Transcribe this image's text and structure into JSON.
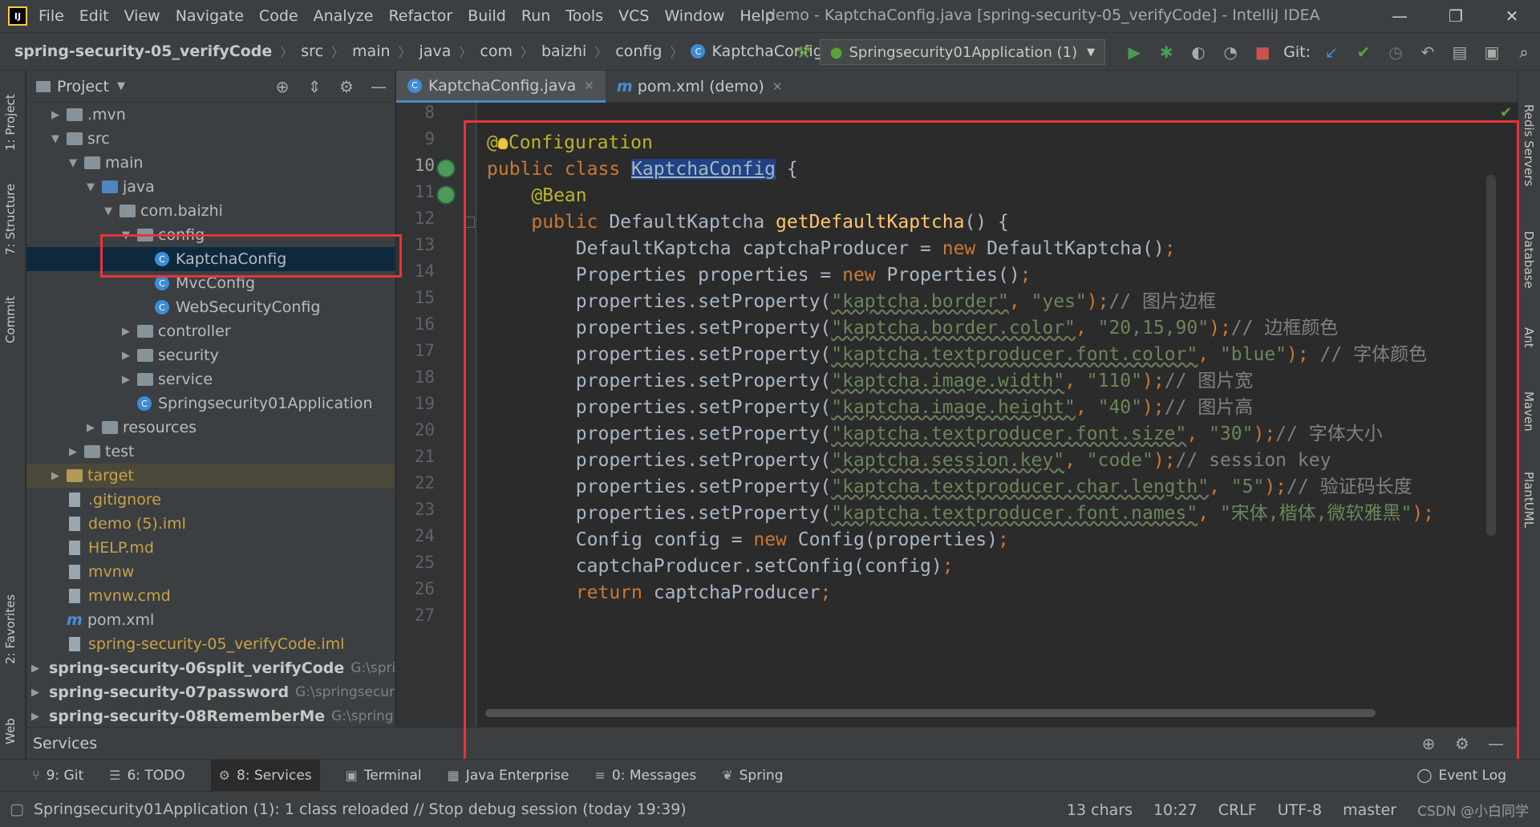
{
  "app": {
    "logo": "IJ",
    "window_title": "demo - KaptchaConfig.java [spring-security-05_verifyCode] - IntelliJ IDEA",
    "menu": [
      "File",
      "Edit",
      "View",
      "Navigate",
      "Code",
      "Analyze",
      "Refactor",
      "Build",
      "Run",
      "Tools",
      "VCS",
      "Window",
      "Help"
    ]
  },
  "breadcrumb": [
    "spring-security-05_verifyCode",
    "src",
    "main",
    "java",
    "com",
    "baizhi",
    "config",
    "KaptchaConfig"
  ],
  "toolbar": {
    "run_config": "Springsecurity01Application (1)",
    "git_label": "Git:"
  },
  "left_tool_tabs": [
    "1: Project",
    "7: Structure",
    "Commit",
    "2: Favorites",
    "Web"
  ],
  "right_tool_tabs": [
    "Redis Servers",
    "Database",
    "Ant",
    "Maven",
    "PlantUML"
  ],
  "project_panel": {
    "title": "Project",
    "tree": [
      {
        "label": ".mvn",
        "kind": "folder",
        "indent": 1,
        "expand": "closed"
      },
      {
        "label": "src",
        "kind": "folder",
        "indent": 1,
        "expand": "open"
      },
      {
        "label": "main",
        "kind": "folder",
        "indent": 2,
        "expand": "open"
      },
      {
        "label": "java",
        "kind": "src-folder",
        "indent": 3,
        "expand": "open"
      },
      {
        "label": "com.baizhi",
        "kind": "package",
        "indent": 4,
        "expand": "open"
      },
      {
        "label": "config",
        "kind": "package",
        "indent": 5,
        "expand": "open"
      },
      {
        "label": "KaptchaConfig",
        "kind": "class",
        "indent": 6,
        "expand": "none",
        "selected": true
      },
      {
        "label": "MvcConfig",
        "kind": "class",
        "indent": 6,
        "expand": "none"
      },
      {
        "label": "WebSecurityConfig",
        "kind": "class",
        "indent": 6,
        "expand": "none"
      },
      {
        "label": "controller",
        "kind": "package",
        "indent": 5,
        "expand": "closed"
      },
      {
        "label": "security",
        "kind": "package",
        "indent": 5,
        "expand": "closed"
      },
      {
        "label": "service",
        "kind": "package",
        "indent": 5,
        "expand": "closed"
      },
      {
        "label": "Springsecurity01Application",
        "kind": "class",
        "indent": 5,
        "expand": "none"
      },
      {
        "label": "resources",
        "kind": "folder",
        "indent": 3,
        "expand": "closed"
      },
      {
        "label": "test",
        "kind": "folder",
        "indent": 2,
        "expand": "closed"
      },
      {
        "label": "target",
        "kind": "target",
        "indent": 1,
        "expand": "closed",
        "excluded": true
      },
      {
        "label": ".gitignore",
        "kind": "file",
        "indent": 1,
        "expand": "none",
        "orange": true
      },
      {
        "label": "demo (5).iml",
        "kind": "file",
        "indent": 1,
        "expand": "none",
        "orange": true
      },
      {
        "label": "HELP.md",
        "kind": "file",
        "indent": 1,
        "expand": "none",
        "orange": true
      },
      {
        "label": "mvnw",
        "kind": "file",
        "indent": 1,
        "expand": "none",
        "orange": true
      },
      {
        "label": "mvnw.cmd",
        "kind": "file",
        "indent": 1,
        "expand": "none",
        "orange": true
      },
      {
        "label": "pom.xml",
        "kind": "maven",
        "indent": 1,
        "expand": "none"
      },
      {
        "label": "spring-security-05_verifyCode.iml",
        "kind": "file",
        "indent": 1,
        "expand": "none",
        "orange": true
      },
      {
        "label": "spring-security-06split_verifyCode",
        "kind": "module",
        "indent": 0,
        "expand": "closed",
        "path": "G:\\springs"
      },
      {
        "label": "spring-security-07password",
        "kind": "module",
        "indent": 0,
        "expand": "closed",
        "path": "G:\\springsecurit"
      },
      {
        "label": "spring-security-08RememberMe",
        "kind": "module",
        "indent": 0,
        "expand": "closed",
        "path": "G:\\springse"
      }
    ]
  },
  "editor_tabs": [
    {
      "label": "KaptchaConfig.java",
      "icon": "C",
      "active": true
    },
    {
      "label": "pom.xml (demo)",
      "icon": "m",
      "active": false
    }
  ],
  "code": {
    "line_numbers": [
      "8",
      "9",
      "10",
      "11",
      "12",
      "13",
      "14",
      "15",
      "16",
      "17",
      "18",
      "19",
      "20",
      "21",
      "22",
      "23",
      "24",
      "25",
      "26",
      "27"
    ],
    "current_line": "10",
    "lines": [
      [],
      [
        {
          "t": "@",
          "c": "ann"
        },
        {
          "t": "bulb",
          "c": "bulb"
        },
        {
          "t": "Configuration",
          "c": "ann"
        }
      ],
      [
        {
          "t": "public class ",
          "c": "kw"
        },
        {
          "t": "KaptchaConfig",
          "c": "sel"
        },
        {
          "t": " {",
          "c": ""
        }
      ],
      [
        {
          "t": "    @Bean",
          "c": "ann"
        }
      ],
      [
        {
          "t": "    ",
          "c": ""
        },
        {
          "t": "public ",
          "c": "kw"
        },
        {
          "t": "DefaultKaptcha ",
          "c": ""
        },
        {
          "t": "getDefaultKaptcha",
          "c": "mth"
        },
        {
          "t": "() {",
          "c": ""
        }
      ],
      [
        {
          "t": "        DefaultKaptcha captchaProducer = ",
          "c": ""
        },
        {
          "t": "new ",
          "c": "kw"
        },
        {
          "t": "DefaultKaptcha()",
          "c": ""
        },
        {
          "t": ";",
          "c": "kw"
        }
      ],
      [
        {
          "t": "        Properties properties = ",
          "c": ""
        },
        {
          "t": "new ",
          "c": "kw"
        },
        {
          "t": "Properties()",
          "c": ""
        },
        {
          "t": ";",
          "c": "kw"
        }
      ],
      [
        {
          "t": "        properties.setProperty(",
          "c": ""
        },
        {
          "t": "\"kaptcha.border\"",
          "c": "str"
        },
        {
          "t": ", ",
          "c": "kw"
        },
        {
          "t": "\"yes\"",
          "c": "str"
        },
        {
          "t": ");",
          "c": "kw"
        },
        {
          "t": "// 图片边框",
          "c": "cmt"
        }
      ],
      [
        {
          "t": "        properties.setProperty(",
          "c": ""
        },
        {
          "t": "\"kaptcha.border.color\"",
          "c": "str"
        },
        {
          "t": ", ",
          "c": "kw"
        },
        {
          "t": "\"20,15,90\"",
          "c": "str"
        },
        {
          "t": ");",
          "c": "kw"
        },
        {
          "t": "// 边框颜色",
          "c": "cmt"
        }
      ],
      [
        {
          "t": "        properties.setProperty(",
          "c": ""
        },
        {
          "t": "\"kaptcha.textproducer.font.color\"",
          "c": "str"
        },
        {
          "t": ", ",
          "c": "kw"
        },
        {
          "t": "\"blue\"",
          "c": "str"
        },
        {
          "t": "); ",
          "c": "kw"
        },
        {
          "t": "// 字体颜色",
          "c": "cmt"
        }
      ],
      [
        {
          "t": "        properties.setProperty(",
          "c": ""
        },
        {
          "t": "\"kaptcha.image.width\"",
          "c": "str"
        },
        {
          "t": ", ",
          "c": "kw"
        },
        {
          "t": "\"110\"",
          "c": "str"
        },
        {
          "t": ");",
          "c": "kw"
        },
        {
          "t": "// 图片宽",
          "c": "cmt"
        }
      ],
      [
        {
          "t": "        properties.setProperty(",
          "c": ""
        },
        {
          "t": "\"kaptcha.image.height\"",
          "c": "str"
        },
        {
          "t": ", ",
          "c": "kw"
        },
        {
          "t": "\"40\"",
          "c": "str"
        },
        {
          "t": ");",
          "c": "kw"
        },
        {
          "t": "// 图片高",
          "c": "cmt"
        }
      ],
      [
        {
          "t": "        properties.setProperty(",
          "c": ""
        },
        {
          "t": "\"kaptcha.textproducer.font.size\"",
          "c": "str"
        },
        {
          "t": ", ",
          "c": "kw"
        },
        {
          "t": "\"30\"",
          "c": "str"
        },
        {
          "t": ");",
          "c": "kw"
        },
        {
          "t": "// 字体大小",
          "c": "cmt"
        }
      ],
      [
        {
          "t": "        properties.setProperty(",
          "c": ""
        },
        {
          "t": "\"kaptcha.session.key\"",
          "c": "str"
        },
        {
          "t": ", ",
          "c": "kw"
        },
        {
          "t": "\"code\"",
          "c": "str"
        },
        {
          "t": ");",
          "c": "kw"
        },
        {
          "t": "// session key",
          "c": "cmt"
        }
      ],
      [
        {
          "t": "        properties.setProperty(",
          "c": ""
        },
        {
          "t": "\"kaptcha.textproducer.char.length\"",
          "c": "str"
        },
        {
          "t": ", ",
          "c": "kw"
        },
        {
          "t": "\"5\"",
          "c": "str"
        },
        {
          "t": ");",
          "c": "kw"
        },
        {
          "t": "// 验证码长度",
          "c": "cmt"
        }
      ],
      [
        {
          "t": "        properties.setProperty(",
          "c": ""
        },
        {
          "t": "\"kaptcha.textproducer.font.names\"",
          "c": "str"
        },
        {
          "t": ", ",
          "c": "kw"
        },
        {
          "t": "\"宋体,楷体,微软雅黑\"",
          "c": "str"
        },
        {
          "t": ");",
          "c": "kw"
        }
      ],
      [
        {
          "t": "        Config config = ",
          "c": ""
        },
        {
          "t": "new ",
          "c": "kw"
        },
        {
          "t": "Config(properties)",
          "c": ""
        },
        {
          "t": ";",
          "c": "kw"
        }
      ],
      [
        {
          "t": "        captchaProducer.setConfig(config)",
          "c": ""
        },
        {
          "t": ";",
          "c": "kw"
        }
      ],
      [
        {
          "t": "        ",
          "c": ""
        },
        {
          "t": "return ",
          "c": "kw"
        },
        {
          "t": "captchaProducer",
          "c": ""
        },
        {
          "t": ";",
          "c": "kw"
        }
      ],
      []
    ]
  },
  "services_bar": {
    "title": "Services"
  },
  "bottom_tabs": [
    {
      "label": "9: Git",
      "icon": "⑂"
    },
    {
      "label": "6: TODO",
      "icon": "☰"
    },
    {
      "label": "8: Services",
      "icon": "⚙",
      "active": true
    },
    {
      "label": "Terminal",
      "icon": "▣"
    },
    {
      "label": "Java Enterprise",
      "icon": "▦"
    },
    {
      "label": "0: Messages",
      "icon": "≡"
    },
    {
      "label": "Spring",
      "icon": "❦"
    }
  ],
  "event_log": "Event Log",
  "status": {
    "message": "Springsecurity01Application (1): 1 class reloaded // Stop debug session (today 19:39)",
    "chars": "13 chars",
    "position": "10:27",
    "line_sep": "CRLF",
    "encoding": "UTF-8",
    "branch": "master",
    "watermark": "CSDN @小白同学"
  }
}
